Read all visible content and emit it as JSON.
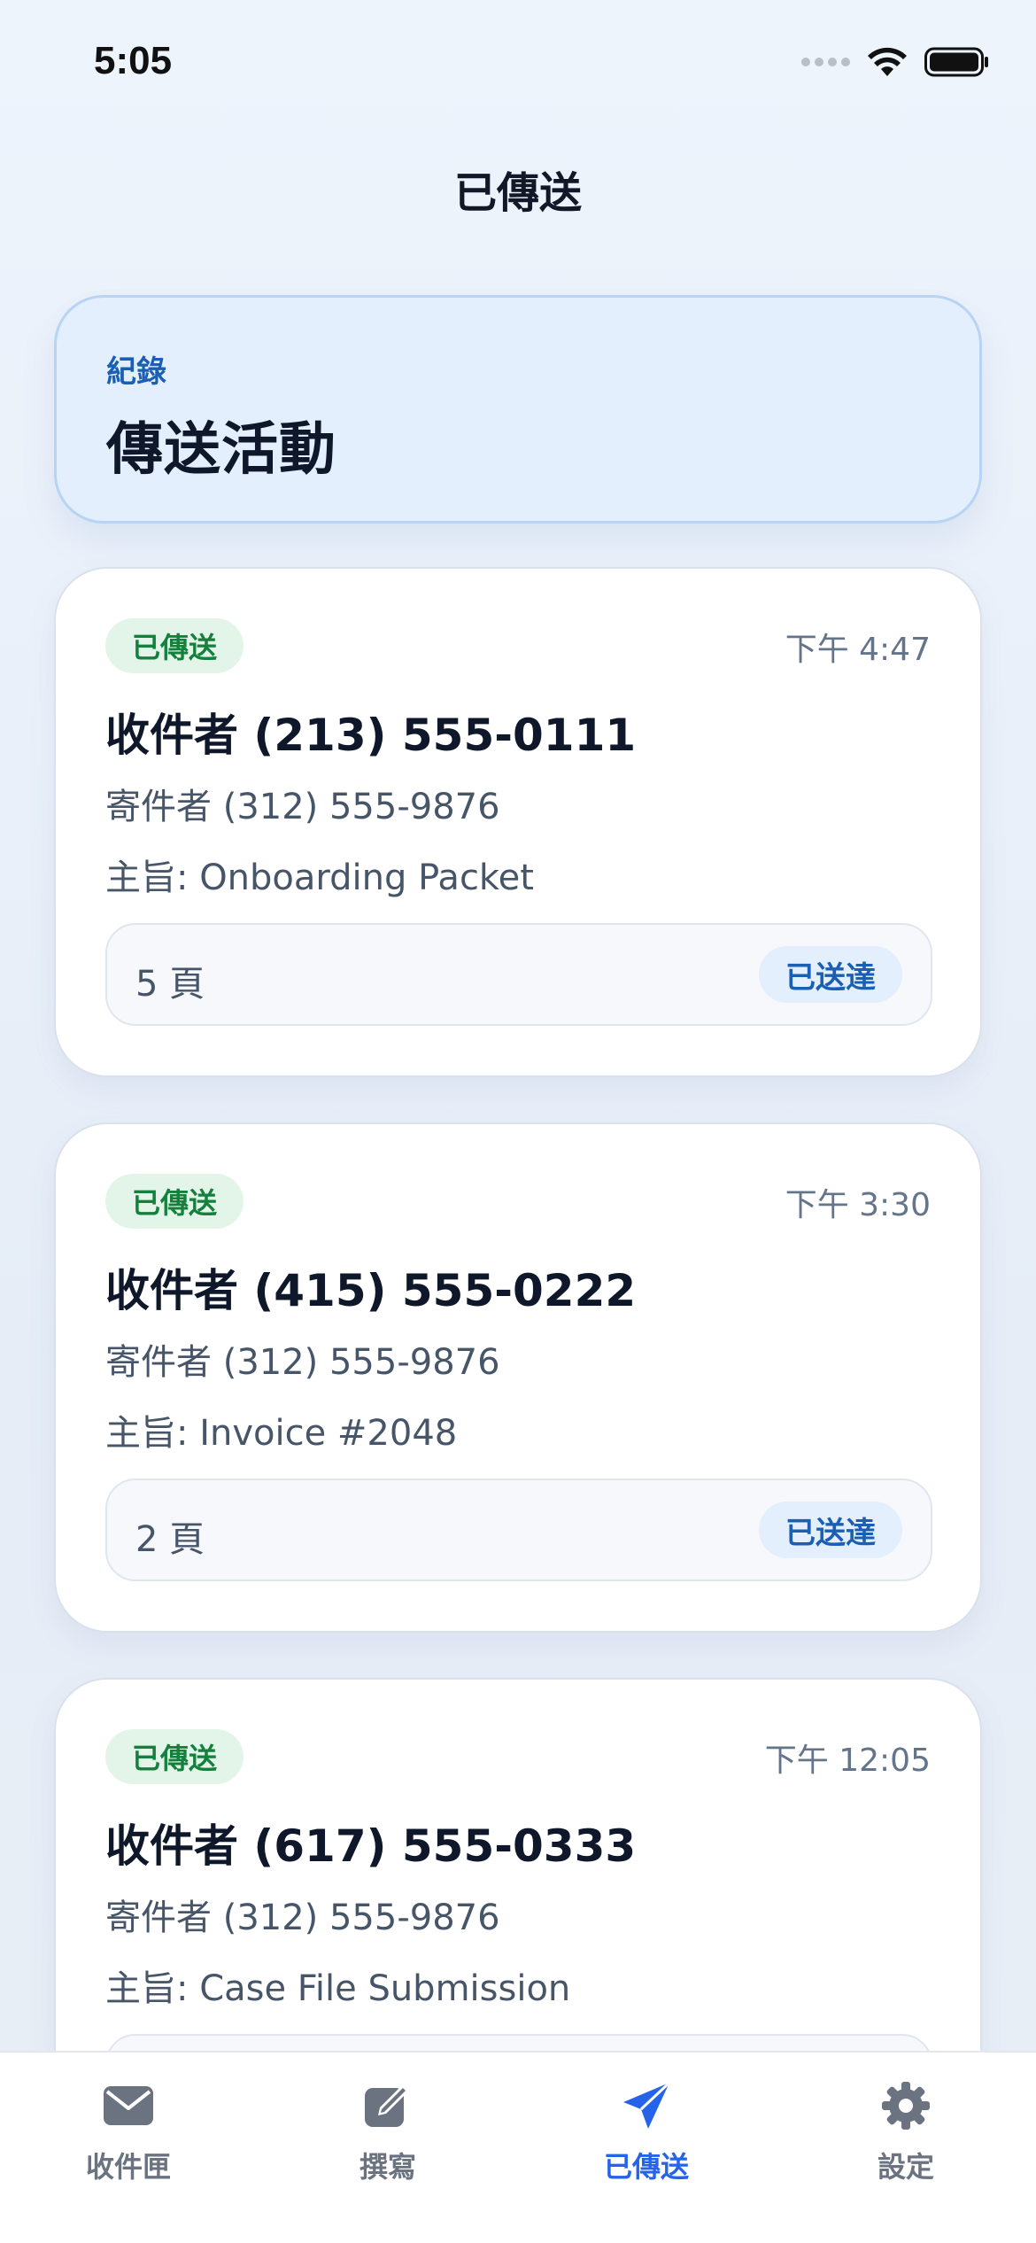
{
  "status_bar": {
    "time": "5:05"
  },
  "nav": {
    "title": "已傳送"
  },
  "header": {
    "eyebrow": "紀錄",
    "title": "傳送活動"
  },
  "faxes": [
    {
      "status": "已傳送",
      "time": "下午 4:47",
      "recipient": "收件者 (213) 555-0111",
      "sender": "寄件者 (312) 555-9876",
      "subject": "主旨: Onboarding Packet",
      "pages": "5 頁",
      "delivery": "已送達"
    },
    {
      "status": "已傳送",
      "time": "下午 3:30",
      "recipient": "收件者 (415) 555-0222",
      "sender": "寄件者 (312) 555-9876",
      "subject": "主旨: Invoice #2048",
      "pages": "2 頁",
      "delivery": "已送達"
    },
    {
      "status": "已傳送",
      "time": "下午 12:05",
      "recipient": "收件者 (617) 555-0333",
      "sender": "寄件者 (312) 555-9876",
      "subject": "主旨: Case File Submission",
      "pages": "",
      "delivery": ""
    }
  ],
  "tabs": [
    {
      "label": "收件匣",
      "icon": "envelope-icon",
      "active": false
    },
    {
      "label": "撰寫",
      "icon": "compose-icon",
      "active": false
    },
    {
      "label": "已傳送",
      "icon": "paper-plane-icon",
      "active": true
    },
    {
      "label": "設定",
      "icon": "gear-icon",
      "active": false
    }
  ],
  "colors": {
    "accent": "#2563eb",
    "sent_green": "#15803d",
    "delivered_blue": "#1a5fb4",
    "inactive_tab": "#6b7280"
  }
}
